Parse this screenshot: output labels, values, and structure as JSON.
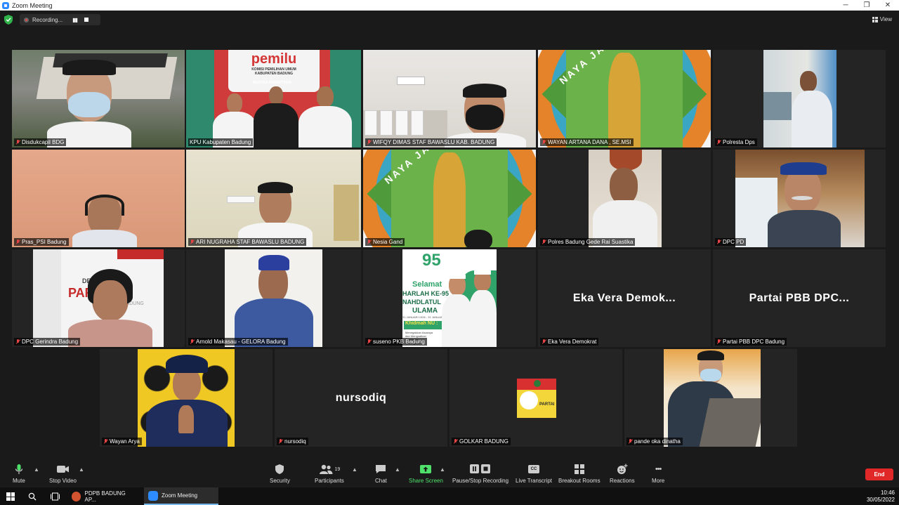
{
  "window": {
    "title": "Zoom Meeting",
    "minimize": "─",
    "maximize": "❐",
    "close": "✕"
  },
  "recording": {
    "label": "Recording...",
    "pause": "▮▮"
  },
  "view": {
    "label": "View"
  },
  "colors": {
    "accent_green": "#4fe06b",
    "end_red": "#e02828",
    "active_speaker": "#d9e24a",
    "mic_muted": "#e64545"
  },
  "participants": [
    {
      "name": "Disdukcapil BDG",
      "row": 0,
      "col": 0
    },
    {
      "name": "KPU Kabupaten Badung",
      "row": 0,
      "col": 1,
      "active_speaker": true
    },
    {
      "name": "WIFQY DIMAS STAF BAWASLU KAB. BADUNG",
      "row": 0,
      "col": 2
    },
    {
      "name": "WAYAN ARTANA DANA , SE.MSI",
      "row": 0,
      "col": 3
    },
    {
      "name": "Polresta Dps",
      "row": 0,
      "col": 4
    },
    {
      "name": "Pras_PSI Badung",
      "row": 1,
      "col": 0
    },
    {
      "name": "ARI NUGRAHA STAF BAWASLU BADUNG",
      "row": 1,
      "col": 1
    },
    {
      "name": "Nesia Gand",
      "row": 1,
      "col": 2
    },
    {
      "name": "Polres Badung Gede Rai Suastika",
      "row": 1,
      "col": 3
    },
    {
      "name": "DPC PD",
      "row": 1,
      "col": 4
    },
    {
      "name": "DPC Gerindra Badung",
      "row": 2,
      "col": 0
    },
    {
      "name": "Arnold Makasau - GELORA Badung",
      "row": 2,
      "col": 1
    },
    {
      "name": "suseno PKB Badung",
      "row": 2,
      "col": 2
    },
    {
      "name": "Eka Vera Demokrat",
      "row": 2,
      "col": 3,
      "no_video_label": "Eka Vera Demok..."
    },
    {
      "name": "Partai PBB DPC Badung",
      "row": 2,
      "col": 4,
      "no_video_label": "Partai PBB DPC..."
    },
    {
      "name": "Wayan Arya",
      "row": 3,
      "col": 0
    },
    {
      "name": "nursodiq",
      "row": 3,
      "col": 1,
      "no_video_label": "nursodiq"
    },
    {
      "name": "GOLKAR BADUNG",
      "row": 3,
      "col": 2
    },
    {
      "name": "pande oka dinatha",
      "row": 3,
      "col": 3
    }
  ],
  "tile_texts": {
    "kpu_banner": "pemilu",
    "kpu_sub1": "KOMISI PEMILIHAN UMUM",
    "kpu_sub2": "KABUPATEN BADUNG",
    "kpu_motto": "MANTRA PRAVRTTAYA",
    "logo_arc": "NAYA     JANA",
    "nu_selamat": "Selamat",
    "nu_harlah": "HARLAH KE-95",
    "nu_nahdlatul": "NAHDLATUL",
    "nu_ulama": "ULAMA",
    "nu_dates": "31 JANUARI 1926 - 31 JANUARI 2021",
    "nu_khidmah": "Khidmah NU :",
    "nu_tagline1": "Menegakkan Asasnya",
    "nu_tagline2": "dan Menguatkan",
    "nu_tagline3": "Kemitraan",
    "nu_tagline4": "Kebangsaan",
    "nu_95": "95",
    "gerindra_dewan": "DEWAN",
    "gerindra_partai": "PARTAI",
    "gerindra_kab": "KAB. BADUNG",
    "golkar_text": "PARTAI"
  },
  "toolbar": {
    "mute": "Mute",
    "stop_video": "Stop Video",
    "security": "Security",
    "participants": "Participants",
    "participants_count": "19",
    "chat": "Chat",
    "share_screen": "Share Screen",
    "record": "Pause/Stop Recording",
    "live_transcript": "Live Transcript",
    "breakout": "Breakout Rooms",
    "reactions": "Reactions",
    "more": "More",
    "end": "End",
    "cc": "CC",
    "more_dots": "•••"
  },
  "taskbar": {
    "app1": "PDPB BADUNG AP...",
    "app2": "Zoom Meeting",
    "time": "10:46",
    "date": "30/05/2022"
  }
}
